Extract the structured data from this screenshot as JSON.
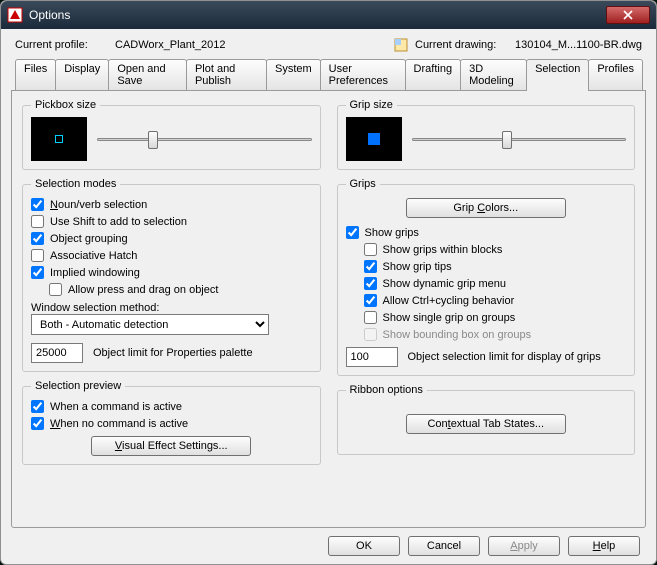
{
  "title": "Options",
  "profile_label": "Current profile:",
  "profile_value": "CADWorx_Plant_2012",
  "drawing_label": "Current drawing:",
  "drawing_value": "130104_M...1100-BR.dwg",
  "tabs": [
    "Files",
    "Display",
    "Open and Save",
    "Plot and Publish",
    "System",
    "User Preferences",
    "Drafting",
    "3D Modeling",
    "Selection",
    "Profiles"
  ],
  "active_tab": 8,
  "left": {
    "pickbox": {
      "legend": "Pickbox size"
    },
    "modes": {
      "legend": "Selection modes",
      "noun_verb": "Noun/verb selection",
      "shift_add": "Use Shift to add to selection",
      "obj_group": "Object grouping",
      "assoc_hatch": "Associative Hatch",
      "implied": "Implied windowing",
      "allow_press": "Allow press and drag on object",
      "win_method_label": "Window selection method:",
      "win_method_value": "Both - Automatic detection",
      "obj_limit_value": "25000",
      "obj_limit_label": "Object limit for Properties palette"
    },
    "preview": {
      "legend": "Selection preview",
      "cmd_active": "When a command is active",
      "no_cmd": "When no command is active",
      "btn": "Visual Effect Settings..."
    }
  },
  "right": {
    "gripsize": {
      "legend": "Grip size"
    },
    "grips": {
      "legend": "Grips",
      "colors_btn": "Grip Colors...",
      "show_grips": "Show grips",
      "within_blocks": "Show grips within blocks",
      "grip_tips": "Show grip tips",
      "dyn_menu": "Show dynamic grip menu",
      "ctrl_cycle": "Allow Ctrl+cycling behavior",
      "single_group": "Show single grip on groups",
      "bbox_group": "Show bounding box on groups",
      "limit_value": "100",
      "limit_label": "Object selection limit for display of grips"
    },
    "ribbon": {
      "legend": "Ribbon options",
      "btn": "Contextual Tab States..."
    }
  },
  "footer": {
    "ok": "OK",
    "cancel": "Cancel",
    "apply": "Apply",
    "help": "Help"
  }
}
